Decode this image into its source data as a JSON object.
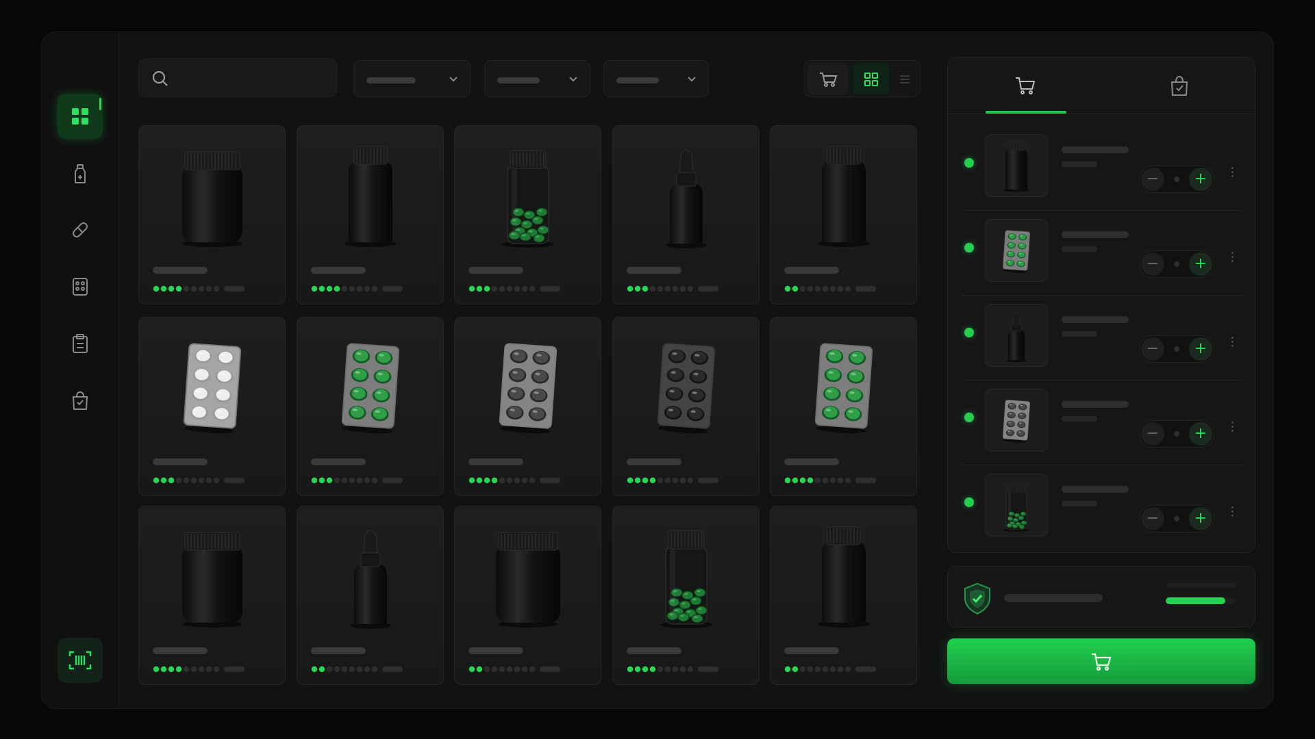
{
  "colors": {
    "accent": "#25d052",
    "background": "#121212",
    "card": "#1b1b1b"
  },
  "sidebar": {
    "items": [
      {
        "name": "dashboard",
        "icon": "grid-icon",
        "active": true
      },
      {
        "name": "bottles",
        "icon": "bottle-icon",
        "active": false
      },
      {
        "name": "pills",
        "icon": "pill-icon",
        "active": false
      },
      {
        "name": "blister",
        "icon": "blister-icon",
        "active": false
      },
      {
        "name": "orders",
        "icon": "clipboard-icon",
        "active": false
      },
      {
        "name": "bag",
        "icon": "bag-icon",
        "active": false
      }
    ],
    "scan_icon": "barcode-scan-icon"
  },
  "toolbar": {
    "search_icon": "search-icon",
    "dropdown_count": 3,
    "view_toggle": [
      "cart-icon",
      "grid-icon",
      "list-icon"
    ],
    "active_view": "grid"
  },
  "products": [
    {
      "kind": "jar",
      "rating": 4
    },
    {
      "kind": "bottle",
      "rating": 4
    },
    {
      "kind": "clear-jar",
      "rating": 3
    },
    {
      "kind": "dropper",
      "rating": 3
    },
    {
      "kind": "bottle",
      "rating": 2
    },
    {
      "kind": "blister-white",
      "rating": 3
    },
    {
      "kind": "blister-green",
      "rating": 3
    },
    {
      "kind": "blister-grey",
      "rating": 4
    },
    {
      "kind": "blister-dark",
      "rating": 4
    },
    {
      "kind": "blister-green",
      "rating": 4
    },
    {
      "kind": "jar",
      "rating": 4
    },
    {
      "kind": "dropper",
      "rating": 2.5
    },
    {
      "kind": "jar-wide",
      "rating": 2
    },
    {
      "kind": "clear-jar",
      "rating": 4
    },
    {
      "kind": "bottle",
      "rating": 2.5
    }
  ],
  "cart": {
    "tabs": [
      "cart-icon",
      "bag-icon"
    ],
    "active_tab": 0,
    "items": [
      {
        "kind": "bottle"
      },
      {
        "kind": "blister-green"
      },
      {
        "kind": "dropper"
      },
      {
        "kind": "blister-grey"
      },
      {
        "kind": "clear-jar"
      }
    ]
  },
  "summary": {
    "icon": "shield-check-icon",
    "progress": 0.85
  },
  "checkout": {
    "icon": "cart-icon"
  }
}
